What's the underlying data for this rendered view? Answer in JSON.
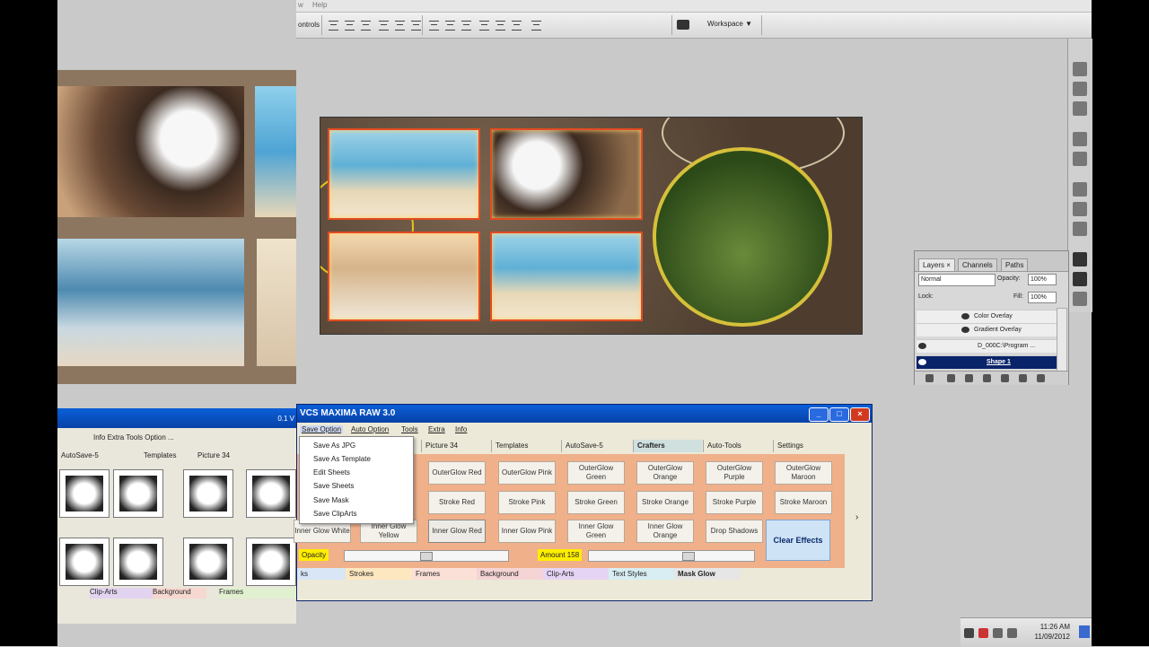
{
  "photoshop": {
    "menu_partial": "w",
    "menu_help": "Help",
    "options_label": "ontrols",
    "workspace_label": "Workspace ▼"
  },
  "layers_panel": {
    "tabs": [
      "Layers ×",
      "Channels",
      "Paths"
    ],
    "blend_mode": "Normal",
    "opacity_label": "Opacity:",
    "opacity_value": "100%",
    "lock_label": "Lock:",
    "fill_label": "Fill:",
    "fill_value": "100%",
    "rows": [
      {
        "label": "Color Overlay"
      },
      {
        "label": "Gradient Overlay"
      },
      {
        "label": "D_000C:\\Program ..."
      },
      {
        "label": "Shape 1"
      }
    ]
  },
  "vcs": {
    "title": "VCS MAXIMA RAW 3.0",
    "menu": [
      "Save Option",
      "Auto Option",
      "Tools",
      "Extra",
      "Info"
    ],
    "tabs": [
      "Picture 34",
      "Templates",
      "AutoSave-5",
      "Crafters",
      "Auto-Tools",
      "Settings"
    ],
    "dropdown": [
      "Save As JPG",
      "Save As Template",
      "Edit Sheets",
      "Save Sheets",
      "Save Mask",
      "Save ClipArts"
    ],
    "row1": [
      "OuterGlow Red",
      "OuterGlow Pink",
      "OuterGlow Green",
      "OuterGlow Orange",
      "OuterGlow Purple",
      "OuterGlow Maroon"
    ],
    "row2": [
      "Stroke Red",
      "Stroke Pink",
      "Stroke Green",
      "Stroke Orange",
      "Stroke Purple",
      "Stroke Maroon"
    ],
    "row3": [
      "Inner Glow White",
      "Inner Glow Yellow",
      "Inner Glow Red",
      "Inner Glow Pink",
      "Inner Glow Green",
      "Inner Glow Orange",
      "Drop Shadows"
    ],
    "clear_effects": "Clear Effects",
    "opacity_label": "Opacity",
    "amount_label": "Amount 158",
    "bottom_tabs": [
      "ks",
      "Strokes",
      "Frames",
      "Background",
      "Clip-Arts",
      "Text Styles",
      "Mask Glow"
    ],
    "window_buttons": [
      "_",
      "□",
      "×"
    ]
  },
  "left_vcs": {
    "version": "0.1 V",
    "menu_mirrored": "Info   Extra  Tools  Option  ...",
    "tabs_mirrored": [
      "AutoSave-5",
      "Templates",
      "Picture 34"
    ],
    "bottom_mirrored": [
      "Clip-Arts",
      "Background",
      "Frames"
    ]
  },
  "tray": {
    "time": "11:26 AM",
    "date": "11/09/2012"
  },
  "colors": {
    "vcs_body": "#f0b08a",
    "title_bar": "#0a4fc8",
    "selected_layer": "#0a246a",
    "highlight_yellow": "#ffee00"
  }
}
